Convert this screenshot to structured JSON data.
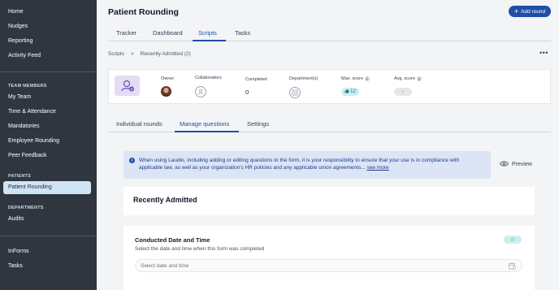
{
  "sidebar": {
    "items_top": [
      {
        "label": "Home",
        "name": "sidebar-item-home"
      },
      {
        "label": "Nudges",
        "name": "sidebar-item-nudges"
      },
      {
        "label": "Reporting",
        "name": "sidebar-item-reporting"
      },
      {
        "label": "Activity Feed",
        "name": "sidebar-item-activity-feed"
      }
    ],
    "team_section": "TEAM MEMBERS",
    "team_items": [
      {
        "label": "My Team"
      },
      {
        "label": "Time & Attendance"
      },
      {
        "label": "Mandatories"
      },
      {
        "label": "Employee Rounding"
      },
      {
        "label": "Peer Feedback"
      }
    ],
    "patients_section": "PATIENTS",
    "patients_active": "Patient Rounding",
    "departments_section": "DEPARTMENTS",
    "departments_items": [
      {
        "label": "Audits"
      }
    ],
    "bottom_items": [
      {
        "label": "InForms"
      },
      {
        "label": "Tasks"
      }
    ]
  },
  "header": {
    "title": "Patient Rounding",
    "add_round_label": "Add round"
  },
  "top_tabs": [
    {
      "label": "Tracker"
    },
    {
      "label": "Dashboard"
    },
    {
      "label": "Scripts",
      "active": true
    },
    {
      "label": "Tasks"
    }
  ],
  "breadcrumb": {
    "root": "Scripts",
    "separator": ">",
    "current": "Recently Admitted (2)"
  },
  "summary": {
    "owner_label": "Owner",
    "collaborators_label": "Collaborators",
    "completed_label": "Completed",
    "completed_value": "0",
    "department_label": "Department(s)",
    "max_score_label": "Max. score",
    "max_score_value": "12",
    "avg_score_label": "Avg. score",
    "avg_score_value": "-"
  },
  "sub_tabs": [
    {
      "label": "Individual rounds"
    },
    {
      "label": "Manage questions",
      "active": true
    },
    {
      "label": "Settings"
    }
  ],
  "banner": {
    "text": "When using Laudio, including adding or editing questions to the form, it is your responsibility to ensure that your use is in compliance with applicable law, as well as your organization's HR policies and any applicable union agreements...",
    "link": "see more"
  },
  "preview_label": "Preview",
  "form": {
    "title": "Recently Admitted"
  },
  "question": {
    "title": "Conducted Date and Time",
    "subtitle": "Select the date and time when this form was completed",
    "placeholder": "Select date and time",
    "star": "☆"
  },
  "colors": {
    "sidebar_bg": "#2f3640",
    "accent": "#1d4fa8",
    "active_nav": "#cfe4f5",
    "banner_bg": "#dbe5f6",
    "badge_teal": "#cdeef0"
  }
}
